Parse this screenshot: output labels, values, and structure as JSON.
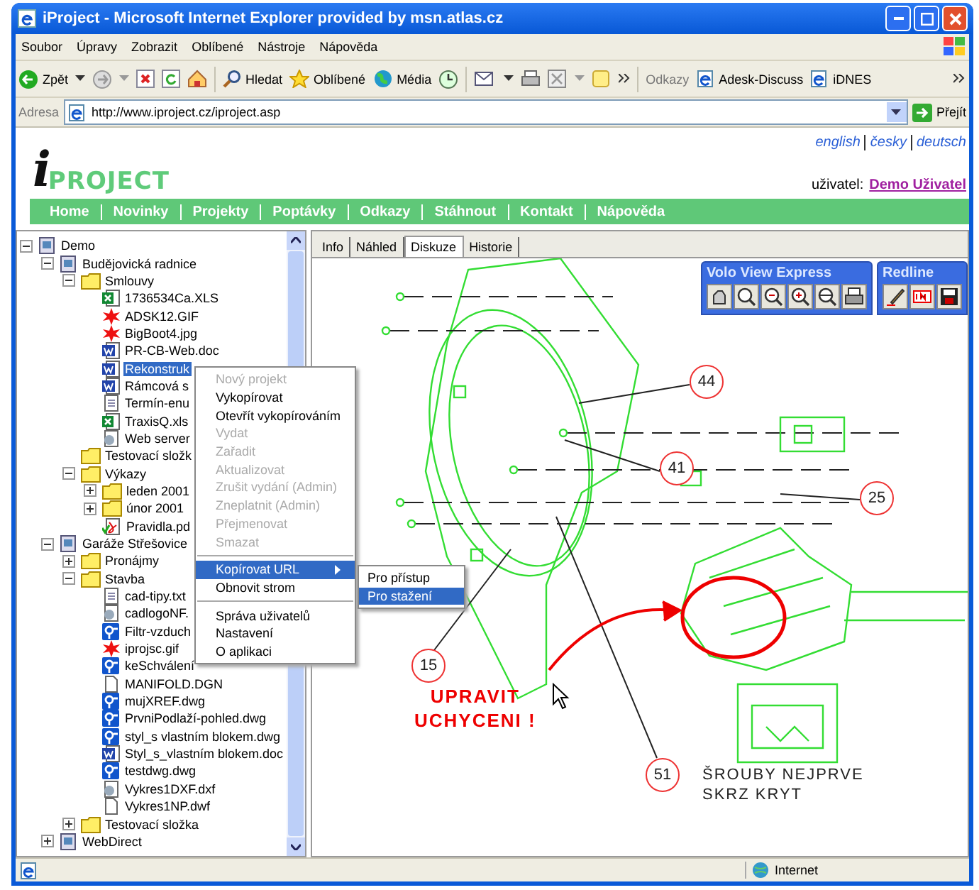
{
  "window": {
    "title": "iProject - Microsoft Internet Explorer provided by msn.atlas.cz"
  },
  "menu": [
    "Soubor",
    "Úpravy",
    "Zobrazit",
    "Oblíbené",
    "Nástroje",
    "Nápověda"
  ],
  "toolbar": {
    "back": "Zpět",
    "search": "Hledat",
    "favorites": "Oblíbené",
    "media": "Média",
    "links_label": "Odkazy",
    "links": [
      "Adesk-Discuss",
      "iDNES"
    ]
  },
  "address": {
    "label": "Adresa",
    "url": "http://www.iproject.cz/iproject.asp",
    "go": "Přejít"
  },
  "languages": [
    "english",
    "česky",
    "deutsch"
  ],
  "logo": {
    "mark": "i",
    "text": "PROJECT"
  },
  "user": {
    "label": "uživatel:",
    "name": "Demo Uživatel"
  },
  "nav": [
    "Home",
    "Novinky",
    "Projekty",
    "Poptávky",
    "Odkazy",
    "Stáhnout",
    "Kontakt",
    "Nápověda"
  ],
  "tree": [
    {
      "label": "Demo",
      "kind": "project",
      "expanded": true,
      "selected": false,
      "children": [
        {
          "label": "Budějovická radnice",
          "kind": "project",
          "expanded": true,
          "selected": false,
          "children": [
            {
              "label": "Smlouvy",
              "kind": "folder",
              "expanded": true,
              "selected": false,
              "children": [
                {
                  "label": "1736534Ca.XLS",
                  "kind": "xls",
                  "selected": false
                },
                {
                  "label": "ADSK12.GIF",
                  "kind": "image",
                  "selected": false
                },
                {
                  "label": "BigBoot4.jpg",
                  "kind": "image",
                  "selected": false
                },
                {
                  "label": "PR-CB-Web.doc",
                  "kind": "doc",
                  "selected": false
                },
                {
                  "label": "Rekonstruk",
                  "kind": "doc",
                  "selected": true
                },
                {
                  "label": "Rámcová s",
                  "kind": "doc",
                  "selected": false
                },
                {
                  "label": "Termín-enu",
                  "kind": "text",
                  "selected": false
                },
                {
                  "label": "TraxisQ.xls",
                  "kind": "xls",
                  "selected": false
                },
                {
                  "label": "Web server",
                  "kind": "web",
                  "selected": false
                }
              ]
            },
            {
              "label": "Testovací složk",
              "kind": "folder",
              "selected": false
            },
            {
              "label": "Výkazy",
              "kind": "folder",
              "expanded": true,
              "selected": false,
              "children": [
                {
                  "label": "leden 2001",
                  "kind": "folder",
                  "expanded": false,
                  "selected": false
                },
                {
                  "label": "únor 2001",
                  "kind": "folder",
                  "expanded": false,
                  "selected": false
                },
                {
                  "label": "Pravidla.pd",
                  "kind": "pdf",
                  "selected": false
                }
              ]
            }
          ]
        },
        {
          "label": "Garáže Střešovice",
          "kind": "project",
          "expanded": true,
          "selected": false,
          "children": [
            {
              "label": "Pronájmy",
              "kind": "folder",
              "expanded": false,
              "selected": false
            },
            {
              "label": "Stavba",
              "kind": "folder",
              "expanded": true,
              "selected": false,
              "children": [
                {
                  "label": "cad-tipy.txt",
                  "kind": "text",
                  "selected": false
                },
                {
                  "label": "cadlogoNF.",
                  "kind": "web",
                  "selected": false
                },
                {
                  "label": "Filtr-vzduch",
                  "kind": "dwg",
                  "selected": false
                },
                {
                  "label": "iprojsc.gif",
                  "kind": "image",
                  "selected": false
                },
                {
                  "label": "keSchválení",
                  "kind": "dwg",
                  "selected": false
                },
                {
                  "label": "MANIFOLD.DGN",
                  "kind": "file",
                  "selected": false
                },
                {
                  "label": "mujXREF.dwg",
                  "kind": "dwg",
                  "selected": false
                },
                {
                  "label": "PrvniPodlaží-pohled.dwg",
                  "kind": "dwg",
                  "selected": false
                },
                {
                  "label": "styl_s vlastním blokem.dwg",
                  "kind": "dwg",
                  "selected": false
                },
                {
                  "label": "Styl_s_vlastním blokem.doc",
                  "kind": "doc",
                  "selected": false
                },
                {
                  "label": "testdwg.dwg",
                  "kind": "dwg",
                  "selected": false
                },
                {
                  "label": "Vykres1DXF.dxf",
                  "kind": "web",
                  "selected": false
                },
                {
                  "label": "Vykres1NP.dwf",
                  "kind": "file",
                  "selected": false
                }
              ]
            },
            {
              "label": "Testovací složka",
              "kind": "folder",
              "expanded": false,
              "selected": false
            }
          ]
        },
        {
          "label": "WebDirect",
          "kind": "project",
          "expanded": false,
          "selected": false
        }
      ]
    }
  ],
  "context_menu": [
    {
      "kind": "item",
      "label": "Nový projekt",
      "disabled": true,
      "selected": false
    },
    {
      "kind": "item",
      "label": "Vykopírovat",
      "disabled": false,
      "selected": false
    },
    {
      "kind": "item",
      "label": "Otevřít vykopírováním",
      "disabled": false,
      "selected": false
    },
    {
      "kind": "item",
      "label": "Vydat",
      "disabled": true,
      "selected": false
    },
    {
      "kind": "item",
      "label": "Zařadit",
      "disabled": true,
      "selected": false
    },
    {
      "kind": "item",
      "label": "Aktualizovat",
      "disabled": true,
      "selected": false
    },
    {
      "kind": "item",
      "label": "Zrušit vydání (Admin)",
      "disabled": true,
      "selected": false
    },
    {
      "kind": "item",
      "label": "Zneplatnit (Admin)",
      "disabled": true,
      "selected": false
    },
    {
      "kind": "item",
      "label": "Přejmenovat",
      "disabled": true,
      "selected": false
    },
    {
      "kind": "item",
      "label": "Smazat",
      "disabled": true,
      "selected": false
    },
    {
      "kind": "separator"
    },
    {
      "kind": "submenu",
      "label": "Kopírovat URL",
      "disabled": false,
      "selected": true
    },
    {
      "kind": "item",
      "label": "Obnovit strom",
      "disabled": false,
      "selected": false
    },
    {
      "kind": "separator"
    },
    {
      "kind": "item",
      "label": "Správa uživatelů",
      "disabled": false,
      "selected": false
    },
    {
      "kind": "item",
      "label": "Nastavení",
      "disabled": false,
      "selected": false
    },
    {
      "kind": "item",
      "label": "O aplikaci",
      "disabled": false,
      "selected": false
    }
  ],
  "submenu": [
    {
      "label": "Pro přístup",
      "selected": false
    },
    {
      "label": "Pro stažení",
      "selected": true
    }
  ],
  "tabs": [
    {
      "label": "Info",
      "selected": false
    },
    {
      "label": "Náhled",
      "selected": false
    },
    {
      "label": "Diskuze",
      "selected": true
    },
    {
      "label": "Historie",
      "selected": false
    }
  ],
  "panels": [
    {
      "kind": "viewer",
      "title": "Volo View Express"
    },
    {
      "kind": "redline",
      "title": "Redline"
    }
  ],
  "drawing": {
    "callouts": [
      "44",
      "41",
      "25",
      "15",
      "51"
    ],
    "redline_note": [
      "UPRAVIT",
      "UCHYCENI !"
    ],
    "note": [
      "ŠROUBY NEJPRVE",
      "SKRZ KRYT"
    ]
  },
  "status_bar": {
    "zone": "Internet"
  }
}
